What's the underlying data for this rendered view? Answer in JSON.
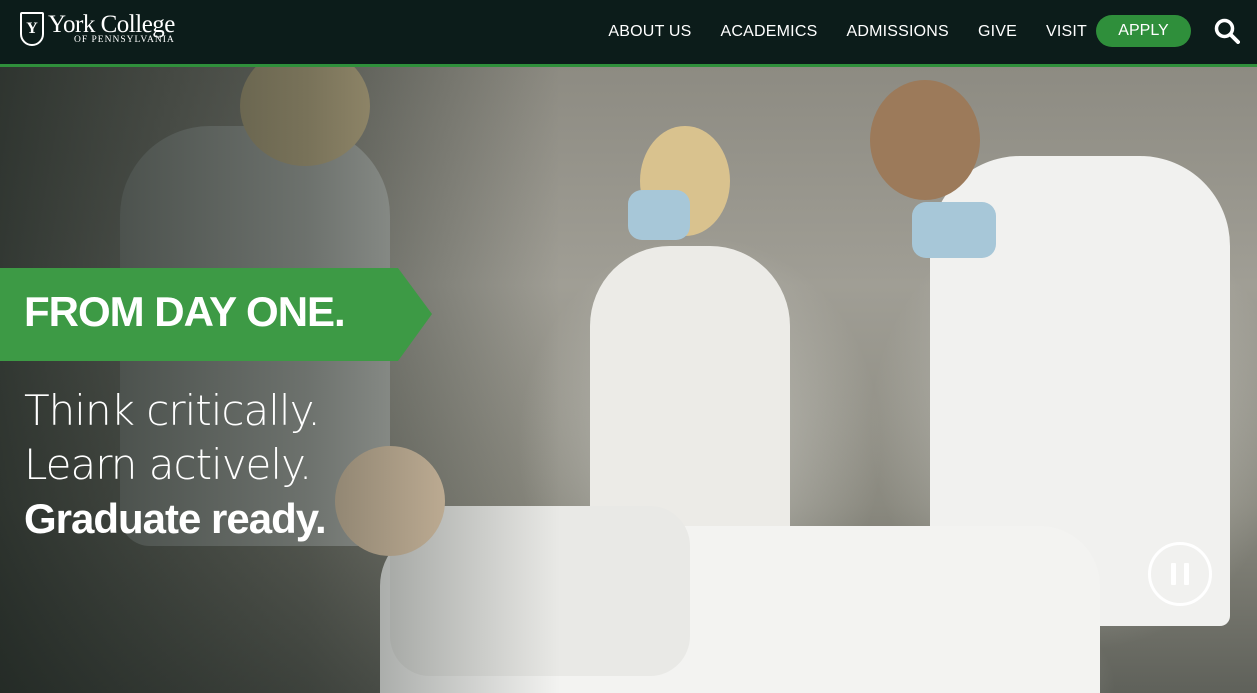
{
  "header": {
    "logo": {
      "name": "York College",
      "subtitle": "OF PENNSYLVANIA",
      "mark": "Y"
    },
    "nav": [
      "ABOUT US",
      "ACADEMICS",
      "ADMISSIONS",
      "GIVE",
      "VISIT"
    ],
    "apply_label": "APPLY",
    "search_icon": "search-icon"
  },
  "hero": {
    "banner": "FROM DAY ONE.",
    "lines": [
      "Think critically.",
      "Learn actively.",
      "Graduate ready."
    ],
    "pause_icon": "pause-icon"
  },
  "colors": {
    "nav_bg": "#0c1c1a",
    "accent_green": "#3d9a45",
    "button_green": "#2f8f3b"
  }
}
